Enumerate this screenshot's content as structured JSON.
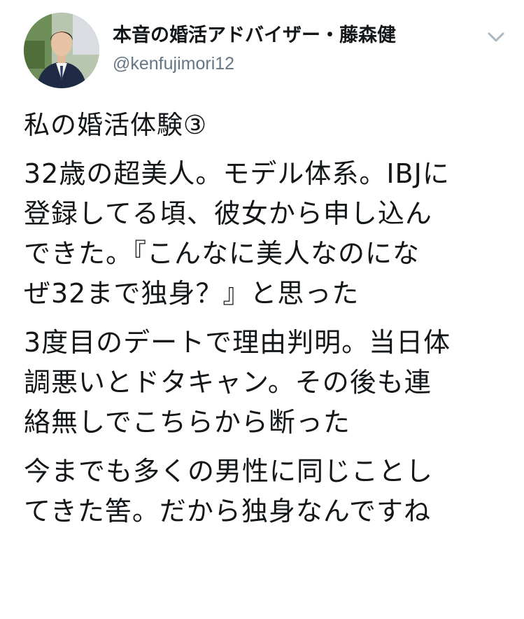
{
  "tweet": {
    "author": {
      "display_name": "本音の婚活アドバイザー・藤森健",
      "handle": "@kenfujimori12"
    },
    "menu_icon": "chevron-down-icon",
    "paragraphs": [
      "私の婚活体験③",
      "32歳の超美人。モデル体系。IBJに\n登録してる頃、彼女から申し込ん\nできた。『こんなに美人なのにな\nぜ32まで独身？』と思った",
      "3度目のデートで理由判明。当日体\n調悪いとドタキャン。その後も連\n絡無しでこちらから断った",
      "今までも多くの男性に同じことし\nてきた筈。だから独身なんですね"
    ]
  },
  "colors": {
    "text": "#14171a",
    "secondary": "#657786",
    "chevron": "#aab8c2"
  }
}
